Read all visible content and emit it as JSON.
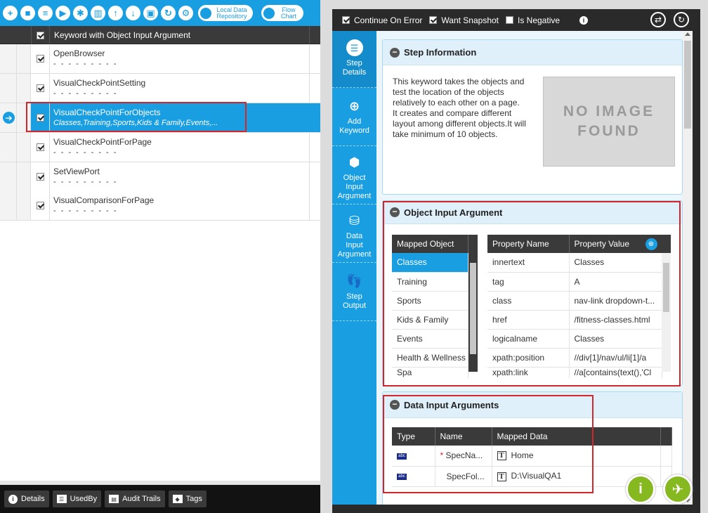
{
  "toolbar": {
    "icons": [
      "add-icon",
      "record-icon",
      "list-icon",
      "play-icon",
      "debug-icon",
      "delete-icon",
      "move-up-icon",
      "move-down-icon",
      "save-icon",
      "refresh-icon",
      "settings-icon"
    ],
    "local_data_repository": "Local Data Repository",
    "flow_chart": "Flow Chart"
  },
  "grid": {
    "header": "Keyword with Object Input Argument",
    "rows": [
      {
        "name": "OpenBrowser",
        "sub": "- - - - - - - - -",
        "checked": true
      },
      {
        "name": "VisualCheckPointSetting",
        "sub": "- - - - - - - - -",
        "checked": true
      },
      {
        "name": "VisualCheckPointForObjects",
        "sub": "Classes,Training,Sports,Kids & Family,Events,...",
        "checked": true,
        "selected": true
      },
      {
        "name": "VisualCheckPointForPage",
        "sub": "- - - - - - - - -",
        "checked": true
      },
      {
        "name": "SetViewPort",
        "sub": "- - - - - - - - -",
        "checked": true
      },
      {
        "name": "VisualComparisonForPage",
        "sub": "- - - - - - - - -",
        "checked": true
      }
    ]
  },
  "bottom_tabs": {
    "details": "Details",
    "used_by": "UsedBy",
    "audit_trails": "Audit Trails",
    "tags": "Tags"
  },
  "options": {
    "continue_on_error": "Continue On Error",
    "want_snapshot": "Want Snapshot",
    "is_negative": "Is Negative"
  },
  "side_nav": {
    "step_details": "Step Details",
    "add_keyword": "Add Keyword",
    "object_input_argument": "Object Input Argument",
    "data_input_argument": "Data Input Argument",
    "step_output": "Step Output"
  },
  "step_info": {
    "title": "Step Information",
    "description": "This keyword takes the objects and test the location of the objects relatively to each other on a page. It creates and compare different layout among different objects.It will take minimum of 10 objects.",
    "no_image": "NO IMAGE FOUND"
  },
  "object_input": {
    "title": "Object Input Argument",
    "mapped_object_header": "Mapped Object",
    "mapped_objects": [
      "Classes",
      "Training",
      "Sports",
      "Kids & Family",
      "Events",
      "Health & Wellness",
      "Spa"
    ],
    "property_name_header": "Property Name",
    "property_value_header": "Property Value",
    "properties": [
      {
        "name": "innertext",
        "value": "Classes"
      },
      {
        "name": "tag",
        "value": "A"
      },
      {
        "name": "class",
        "value": "nav-link dropdown-t..."
      },
      {
        "name": "href",
        "value": "/fitness-classes.html"
      },
      {
        "name": "logicalname",
        "value": "Classes"
      },
      {
        "name": "xpath:position",
        "value": "//div[1]/nav/ul/li[1]/a"
      },
      {
        "name": "xpath:link",
        "value": "//a[contains(text(),'Cl"
      }
    ]
  },
  "data_input": {
    "title": "Data Input Arguments",
    "headers": {
      "type": "Type",
      "name": "Name",
      "mapped_data": "Mapped Data"
    },
    "rows": [
      {
        "type_icon": "abc",
        "required": "*",
        "name": "SpecNa...",
        "mapped": "Home"
      },
      {
        "type_icon": "abc",
        "required": "",
        "name": "SpecFol...",
        "mapped": "D:\\VisualQA1"
      }
    ]
  },
  "colors": {
    "accent": "#1a9ee2",
    "highlight": "#d0262c",
    "action_green": "#86b81f",
    "dark": "#2a2a2a"
  }
}
